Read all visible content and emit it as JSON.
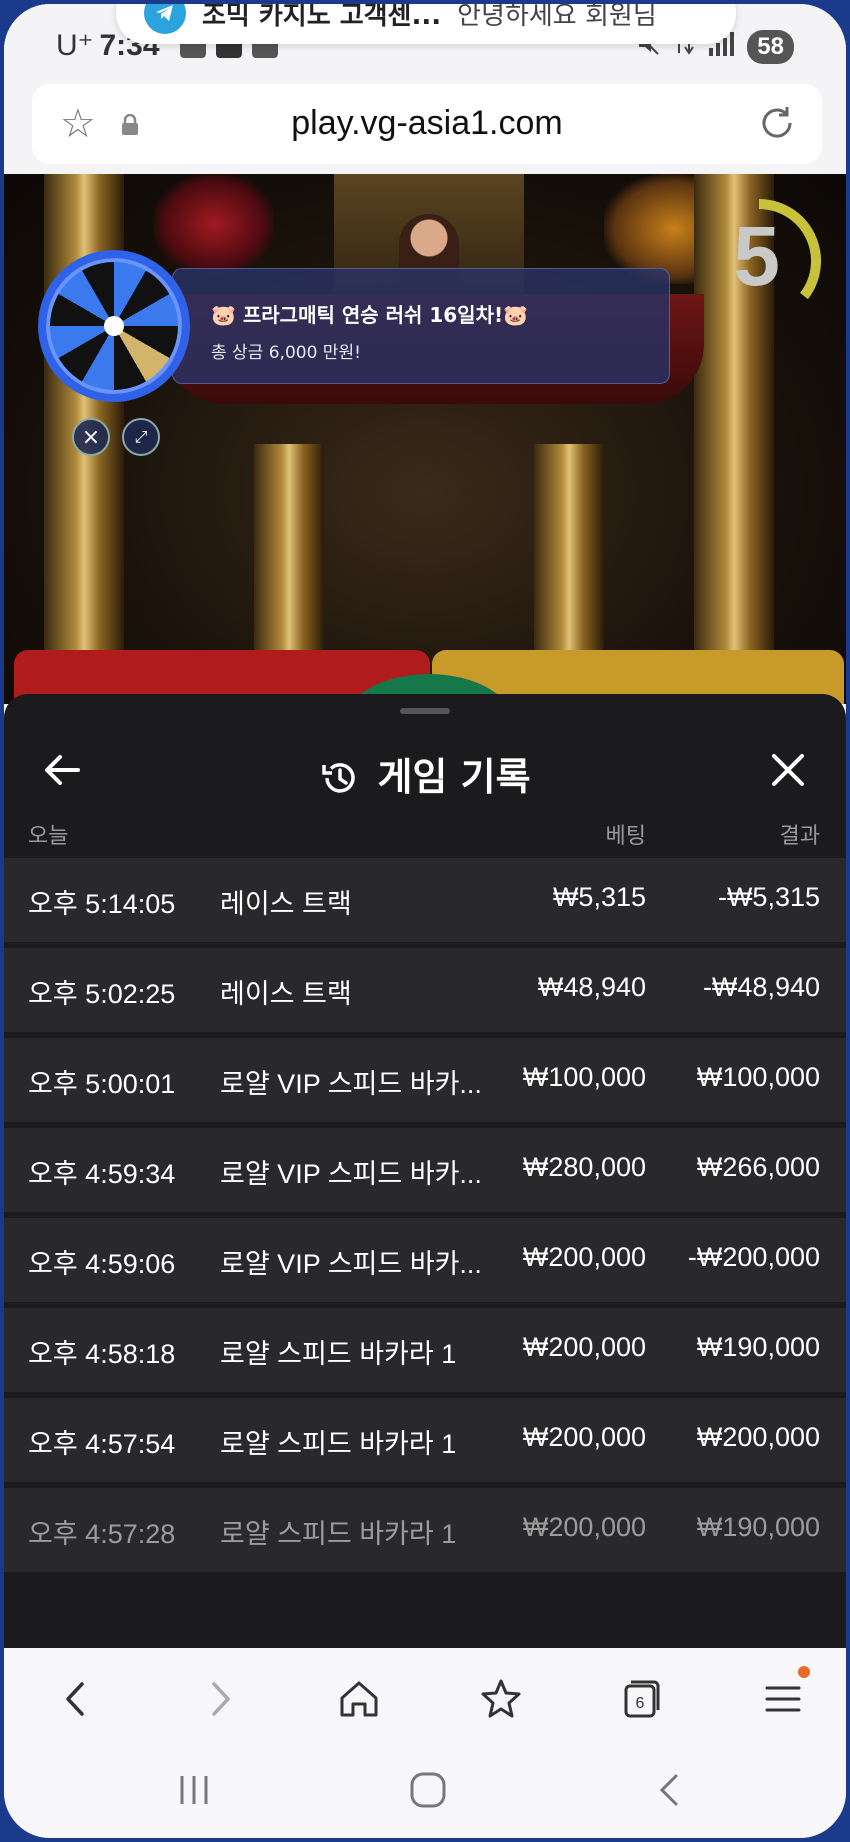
{
  "status_bar": {
    "carrier": "U⁺",
    "time": "7:34",
    "battery": "58"
  },
  "notification": {
    "app_icon": "telegram-icon",
    "title": "조믹 카지노 고객센...",
    "text": "안녕하세요 회원님"
  },
  "browser": {
    "url": "play.vg-asia1.com",
    "tab_count": "6"
  },
  "game": {
    "promo_title": "🐷 프라그매틱 연승 러쉬 16일차!🐷",
    "promo_subtitle": "총 상금 6,000 만원!",
    "timer": "5"
  },
  "history": {
    "title": "게임 기록",
    "columns": {
      "day": "오늘",
      "bet": "베팅",
      "result": "결과"
    },
    "rows": [
      {
        "time": "오후 5:14:05",
        "game": "레이스 트랙",
        "bet": "₩5,315",
        "result": "-₩5,315"
      },
      {
        "time": "오후 5:02:25",
        "game": "레이스 트랙",
        "bet": "₩48,940",
        "result": "-₩48,940"
      },
      {
        "time": "오후 5:00:01",
        "game": "로얄 VIP 스피드 바카...",
        "bet": "₩100,000",
        "result": "₩100,000"
      },
      {
        "time": "오후 4:59:34",
        "game": "로얄 VIP 스피드 바카...",
        "bet": "₩280,000",
        "result": "₩266,000"
      },
      {
        "time": "오후 4:59:06",
        "game": "로얄 VIP 스피드 바카...",
        "bet": "₩200,000",
        "result": "-₩200,000"
      },
      {
        "time": "오후 4:58:18",
        "game": "로얄 스피드 바카라 1",
        "bet": "₩200,000",
        "result": "₩190,000"
      },
      {
        "time": "오후 4:57:54",
        "game": "로얄 스피드 바카라 1",
        "bet": "₩200,000",
        "result": "₩200,000"
      },
      {
        "time": "오후 4:57:28",
        "game": "로얄 스피드 바카라 1",
        "bet": "₩200,000",
        "result": "₩190,000"
      }
    ]
  },
  "colors": {
    "sheet_bg": "#1b1b1d",
    "row_bg": "#29292c",
    "wheel_blue": "#2f62e8",
    "bet_red": "#b01c1c",
    "bet_gold": "#c89a2a"
  }
}
